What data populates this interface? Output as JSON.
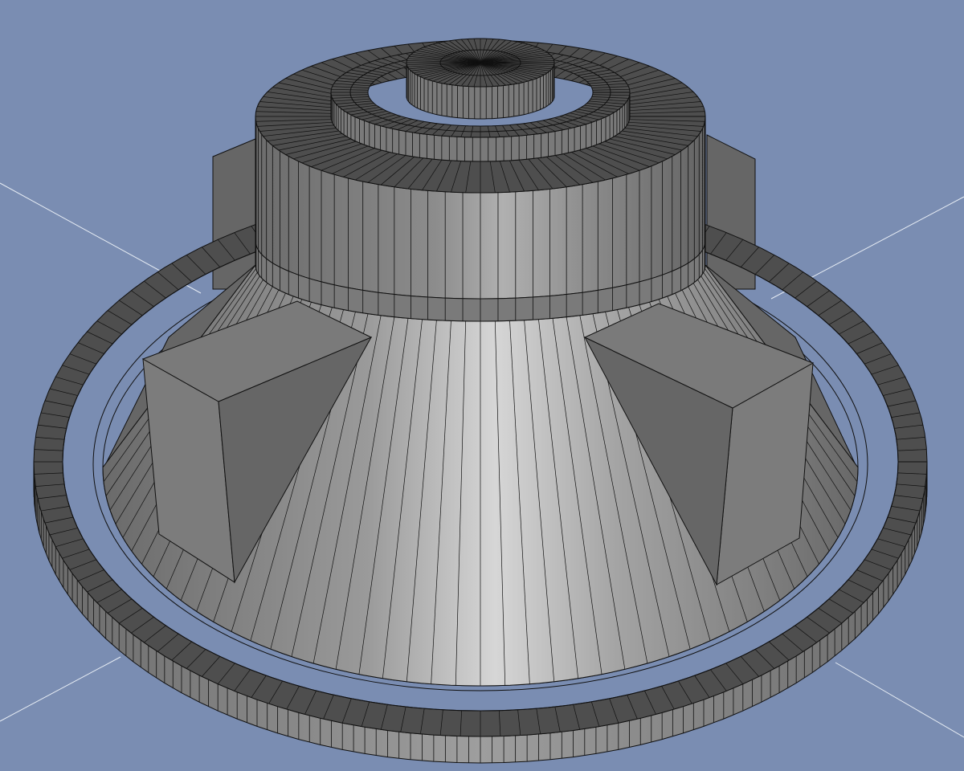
{
  "viewport": {
    "background": "#7a8db2",
    "axis_color": "#e6ecf4",
    "mesh_line_color": "#101010",
    "shading": {
      "dark": "#4e4e4e",
      "mid": "#7a7a7a",
      "light": "#d4d4d4",
      "side": "#7c7c7c",
      "side_dark": "#666666"
    }
  },
  "model": {
    "name_icon": "speaker-driver-mesh-icon",
    "parts": [
      "outer-rim",
      "surround",
      "cone",
      "magnet-blocks",
      "top-plate",
      "magnet-ring",
      "pole-piece",
      "dust-cap"
    ]
  }
}
